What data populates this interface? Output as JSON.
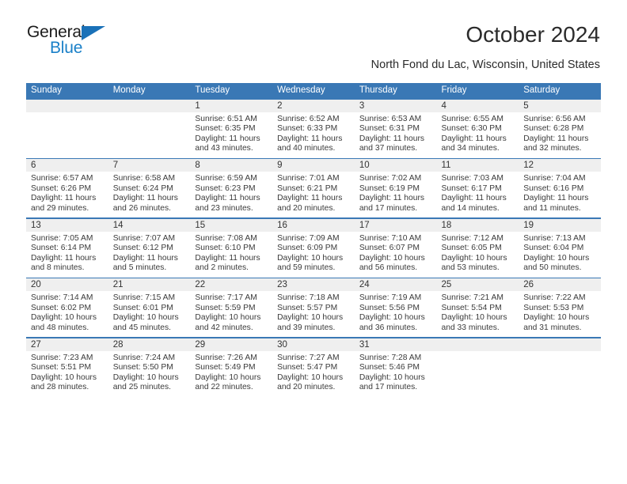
{
  "brand": {
    "name_part1": "General",
    "name_part2": "Blue",
    "accent_color": "#1a80c8",
    "triangle_color": "#1a71b8"
  },
  "header": {
    "title": "October 2024",
    "subtitle": "North Fond du Lac, Wisconsin, United States"
  },
  "calendar": {
    "header_bg": "#3a78b5",
    "daynum_bg": "#efefef",
    "weekdays": [
      "Sunday",
      "Monday",
      "Tuesday",
      "Wednesday",
      "Thursday",
      "Friday",
      "Saturday"
    ],
    "weeks": [
      [
        {
          "day": "",
          "sunrise": "",
          "sunset": "",
          "daylight_line1": "",
          "daylight_line2": ""
        },
        {
          "day": "",
          "sunrise": "",
          "sunset": "",
          "daylight_line1": "",
          "daylight_line2": ""
        },
        {
          "day": "1",
          "sunrise": "Sunrise: 6:51 AM",
          "sunset": "Sunset: 6:35 PM",
          "daylight_line1": "Daylight: 11 hours",
          "daylight_line2": "and 43 minutes."
        },
        {
          "day": "2",
          "sunrise": "Sunrise: 6:52 AM",
          "sunset": "Sunset: 6:33 PM",
          "daylight_line1": "Daylight: 11 hours",
          "daylight_line2": "and 40 minutes."
        },
        {
          "day": "3",
          "sunrise": "Sunrise: 6:53 AM",
          "sunset": "Sunset: 6:31 PM",
          "daylight_line1": "Daylight: 11 hours",
          "daylight_line2": "and 37 minutes."
        },
        {
          "day": "4",
          "sunrise": "Sunrise: 6:55 AM",
          "sunset": "Sunset: 6:30 PM",
          "daylight_line1": "Daylight: 11 hours",
          "daylight_line2": "and 34 minutes."
        },
        {
          "day": "5",
          "sunrise": "Sunrise: 6:56 AM",
          "sunset": "Sunset: 6:28 PM",
          "daylight_line1": "Daylight: 11 hours",
          "daylight_line2": "and 32 minutes."
        }
      ],
      [
        {
          "day": "6",
          "sunrise": "Sunrise: 6:57 AM",
          "sunset": "Sunset: 6:26 PM",
          "daylight_line1": "Daylight: 11 hours",
          "daylight_line2": "and 29 minutes."
        },
        {
          "day": "7",
          "sunrise": "Sunrise: 6:58 AM",
          "sunset": "Sunset: 6:24 PM",
          "daylight_line1": "Daylight: 11 hours",
          "daylight_line2": "and 26 minutes."
        },
        {
          "day": "8",
          "sunrise": "Sunrise: 6:59 AM",
          "sunset": "Sunset: 6:23 PM",
          "daylight_line1": "Daylight: 11 hours",
          "daylight_line2": "and 23 minutes."
        },
        {
          "day": "9",
          "sunrise": "Sunrise: 7:01 AM",
          "sunset": "Sunset: 6:21 PM",
          "daylight_line1": "Daylight: 11 hours",
          "daylight_line2": "and 20 minutes."
        },
        {
          "day": "10",
          "sunrise": "Sunrise: 7:02 AM",
          "sunset": "Sunset: 6:19 PM",
          "daylight_line1": "Daylight: 11 hours",
          "daylight_line2": "and 17 minutes."
        },
        {
          "day": "11",
          "sunrise": "Sunrise: 7:03 AM",
          "sunset": "Sunset: 6:17 PM",
          "daylight_line1": "Daylight: 11 hours",
          "daylight_line2": "and 14 minutes."
        },
        {
          "day": "12",
          "sunrise": "Sunrise: 7:04 AM",
          "sunset": "Sunset: 6:16 PM",
          "daylight_line1": "Daylight: 11 hours",
          "daylight_line2": "and 11 minutes."
        }
      ],
      [
        {
          "day": "13",
          "sunrise": "Sunrise: 7:05 AM",
          "sunset": "Sunset: 6:14 PM",
          "daylight_line1": "Daylight: 11 hours",
          "daylight_line2": "and 8 minutes."
        },
        {
          "day": "14",
          "sunrise": "Sunrise: 7:07 AM",
          "sunset": "Sunset: 6:12 PM",
          "daylight_line1": "Daylight: 11 hours",
          "daylight_line2": "and 5 minutes."
        },
        {
          "day": "15",
          "sunrise": "Sunrise: 7:08 AM",
          "sunset": "Sunset: 6:10 PM",
          "daylight_line1": "Daylight: 11 hours",
          "daylight_line2": "and 2 minutes."
        },
        {
          "day": "16",
          "sunrise": "Sunrise: 7:09 AM",
          "sunset": "Sunset: 6:09 PM",
          "daylight_line1": "Daylight: 10 hours",
          "daylight_line2": "and 59 minutes."
        },
        {
          "day": "17",
          "sunrise": "Sunrise: 7:10 AM",
          "sunset": "Sunset: 6:07 PM",
          "daylight_line1": "Daylight: 10 hours",
          "daylight_line2": "and 56 minutes."
        },
        {
          "day": "18",
          "sunrise": "Sunrise: 7:12 AM",
          "sunset": "Sunset: 6:05 PM",
          "daylight_line1": "Daylight: 10 hours",
          "daylight_line2": "and 53 minutes."
        },
        {
          "day": "19",
          "sunrise": "Sunrise: 7:13 AM",
          "sunset": "Sunset: 6:04 PM",
          "daylight_line1": "Daylight: 10 hours",
          "daylight_line2": "and 50 minutes."
        }
      ],
      [
        {
          "day": "20",
          "sunrise": "Sunrise: 7:14 AM",
          "sunset": "Sunset: 6:02 PM",
          "daylight_line1": "Daylight: 10 hours",
          "daylight_line2": "and 48 minutes."
        },
        {
          "day": "21",
          "sunrise": "Sunrise: 7:15 AM",
          "sunset": "Sunset: 6:01 PM",
          "daylight_line1": "Daylight: 10 hours",
          "daylight_line2": "and 45 minutes."
        },
        {
          "day": "22",
          "sunrise": "Sunrise: 7:17 AM",
          "sunset": "Sunset: 5:59 PM",
          "daylight_line1": "Daylight: 10 hours",
          "daylight_line2": "and 42 minutes."
        },
        {
          "day": "23",
          "sunrise": "Sunrise: 7:18 AM",
          "sunset": "Sunset: 5:57 PM",
          "daylight_line1": "Daylight: 10 hours",
          "daylight_line2": "and 39 minutes."
        },
        {
          "day": "24",
          "sunrise": "Sunrise: 7:19 AM",
          "sunset": "Sunset: 5:56 PM",
          "daylight_line1": "Daylight: 10 hours",
          "daylight_line2": "and 36 minutes."
        },
        {
          "day": "25",
          "sunrise": "Sunrise: 7:21 AM",
          "sunset": "Sunset: 5:54 PM",
          "daylight_line1": "Daylight: 10 hours",
          "daylight_line2": "and 33 minutes."
        },
        {
          "day": "26",
          "sunrise": "Sunrise: 7:22 AM",
          "sunset": "Sunset: 5:53 PM",
          "daylight_line1": "Daylight: 10 hours",
          "daylight_line2": "and 31 minutes."
        }
      ],
      [
        {
          "day": "27",
          "sunrise": "Sunrise: 7:23 AM",
          "sunset": "Sunset: 5:51 PM",
          "daylight_line1": "Daylight: 10 hours",
          "daylight_line2": "and 28 minutes."
        },
        {
          "day": "28",
          "sunrise": "Sunrise: 7:24 AM",
          "sunset": "Sunset: 5:50 PM",
          "daylight_line1": "Daylight: 10 hours",
          "daylight_line2": "and 25 minutes."
        },
        {
          "day": "29",
          "sunrise": "Sunrise: 7:26 AM",
          "sunset": "Sunset: 5:49 PM",
          "daylight_line1": "Daylight: 10 hours",
          "daylight_line2": "and 22 minutes."
        },
        {
          "day": "30",
          "sunrise": "Sunrise: 7:27 AM",
          "sunset": "Sunset: 5:47 PM",
          "daylight_line1": "Daylight: 10 hours",
          "daylight_line2": "and 20 minutes."
        },
        {
          "day": "31",
          "sunrise": "Sunrise: 7:28 AM",
          "sunset": "Sunset: 5:46 PM",
          "daylight_line1": "Daylight: 10 hours",
          "daylight_line2": "and 17 minutes."
        },
        {
          "day": "",
          "sunrise": "",
          "sunset": "",
          "daylight_line1": "",
          "daylight_line2": ""
        },
        {
          "day": "",
          "sunrise": "",
          "sunset": "",
          "daylight_line1": "",
          "daylight_line2": ""
        }
      ]
    ]
  }
}
